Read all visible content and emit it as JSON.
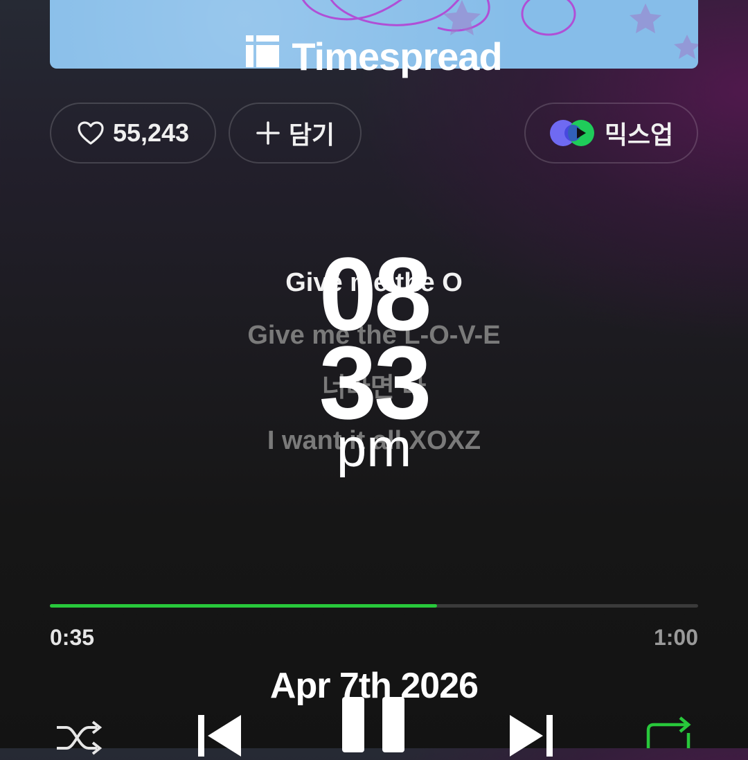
{
  "overlay": {
    "brand": "Timespread",
    "clock_hour": "08",
    "clock_minute": "33",
    "clock_ampm": "pm",
    "date": "Apr 7th 2026"
  },
  "actions": {
    "like_count": "55,243",
    "add_label": "담기",
    "mixup_label": "믹스업"
  },
  "lyrics": {
    "current": "Give me the O",
    "next": [
      "Give me the L-O-V-E",
      "너라면 다",
      "I want it all XOXZ"
    ]
  },
  "player": {
    "progress_fraction": 0.597,
    "elapsed": "0:35",
    "total": "1:00",
    "accent_color": "#28c83b"
  },
  "icons": {
    "like": "heart-icon",
    "add": "plus-icon",
    "mixup": "mixup-icon",
    "shuffle": "shuffle-icon",
    "previous": "previous-icon",
    "pause": "pause-icon",
    "next": "next-icon",
    "repeat": "repeat-icon"
  }
}
